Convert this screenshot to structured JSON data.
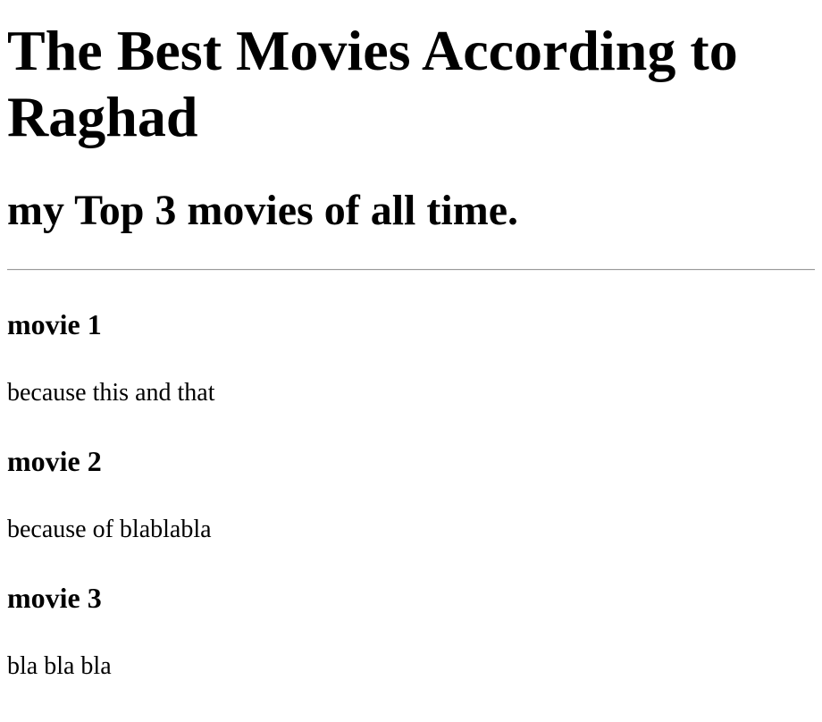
{
  "page": {
    "title": "The Best Movies According to Raghad",
    "subtitle": "my Top 3 movies of all time."
  },
  "movies": [
    {
      "name": "movie 1",
      "reason": "because this and that"
    },
    {
      "name": "movie 2",
      "reason": "because of blablabla"
    },
    {
      "name": "movie 3",
      "reason": "bla bla bla"
    }
  ]
}
